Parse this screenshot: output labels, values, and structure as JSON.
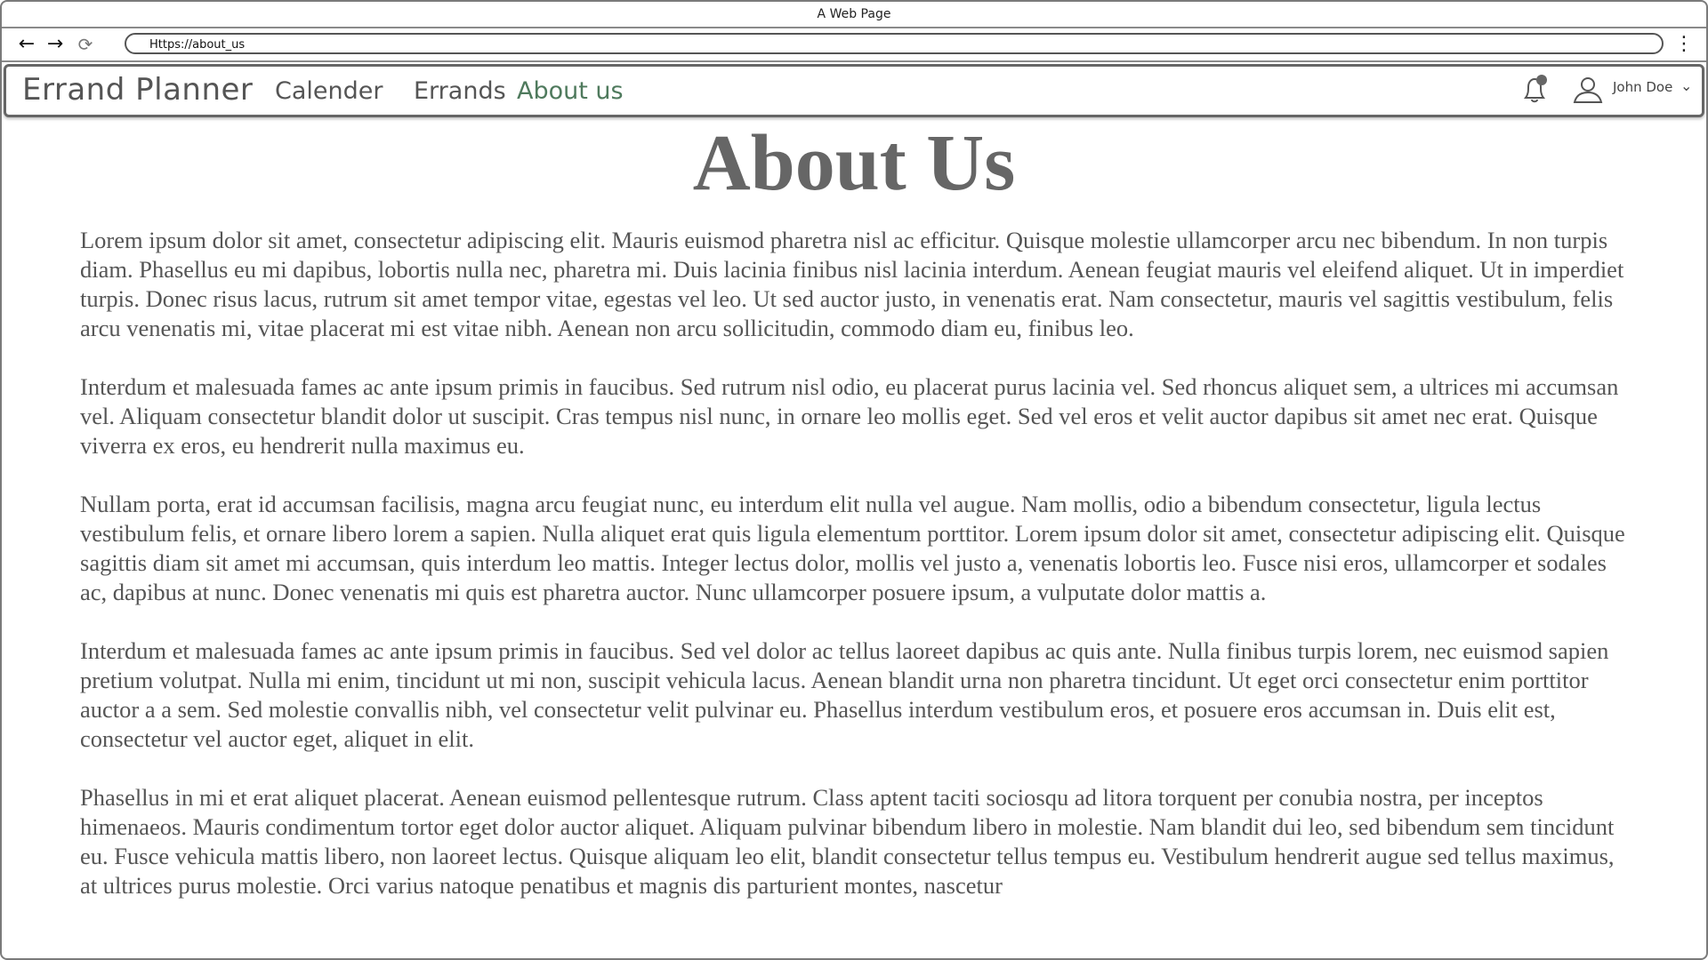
{
  "window": {
    "title": "A Web Page"
  },
  "browser": {
    "url": "Https://about_us",
    "back_icon": "arrow-left-icon",
    "forward_icon": "arrow-right-icon",
    "reload_icon": "reload-icon",
    "menu_icon": "kebab-menu-icon"
  },
  "navbar": {
    "brand": "Errand Planner",
    "links": [
      {
        "label": "Calender",
        "active": false
      },
      {
        "label": "Errands",
        "active": false
      },
      {
        "label": "About us",
        "active": true
      }
    ],
    "active_color": "#4f7a5d",
    "notification_icon": "bell-icon",
    "user_icon": "user-icon",
    "user_name": "John Doe",
    "user_menu_icon": "chevron-down-icon"
  },
  "main": {
    "title": "About Us",
    "paragraphs": [
      "Lorem ipsum dolor sit amet, consectetur adipiscing elit. Mauris euismod pharetra nisl ac efficitur. Quisque molestie ullamcorper arcu nec bibendum. In non turpis diam. Phasellus eu mi dapibus, lobortis nulla nec, pharetra mi. Duis lacinia finibus nisl lacinia interdum. Aenean feugiat mauris vel eleifend aliquet. Ut in imperdiet turpis. Donec risus lacus, rutrum sit amet tempor vitae, egestas vel leo. Ut sed auctor justo, in venenatis erat. Nam consectetur, mauris vel sagittis vestibulum, felis arcu venenatis mi, vitae placerat mi est vitae nibh. Aenean non arcu sollicitudin, commodo diam eu, finibus leo.",
      "Interdum et malesuada fames ac ante ipsum primis in faucibus. Sed rutrum nisl odio, eu placerat purus lacinia vel. Sed rhoncus aliquet sem, a ultrices mi accumsan vel. Aliquam consectetur blandit dolor ut suscipit. Cras tempus nisl nunc, in ornare leo mollis eget. Sed vel eros et velit auctor dapibus sit amet nec erat. Quisque viverra ex eros, eu hendrerit nulla maximus eu.",
      "Nullam porta, erat id accumsan facilisis, magna arcu feugiat nunc, eu interdum elit nulla vel augue. Nam mollis, odio a bibendum consectetur, ligula lectus vestibulum felis, et ornare libero lorem a sapien. Nulla aliquet erat quis ligula elementum porttitor. Lorem ipsum dolor sit amet, consectetur adipiscing elit. Quisque sagittis diam sit amet mi accumsan, quis interdum leo mattis. Integer lectus dolor, mollis vel justo a, venenatis lobortis leo. Fusce nisi eros, ullamcorper et sodales ac, dapibus at nunc. Donec venenatis mi quis est pharetra auctor. Nunc ullamcorper posuere ipsum, a vulputate dolor mattis a.",
      "Interdum et malesuada fames ac ante ipsum primis in faucibus. Sed vel dolor ac tellus laoreet dapibus ac quis ante. Nulla finibus turpis lorem, nec euismod sapien pretium volutpat. Nulla mi enim, tincidunt ut mi non, suscipit vehicula lacus. Aenean blandit urna non pharetra tincidunt. Ut eget orci consectetur enim porttitor auctor a a sem. Sed molestie convallis nibh, vel consectetur velit pulvinar eu. Phasellus interdum vestibulum eros, et posuere eros accumsan in. Duis elit est, consectetur vel auctor eget, aliquet in elit.",
      "Phasellus in mi et erat aliquet placerat. Aenean euismod pellentesque rutrum. Class aptent taciti sociosqu ad litora torquent per conubia nostra, per inceptos himenaeos. Mauris condimentum tortor eget dolor auctor aliquet. Aliquam pulvinar bibendum libero in molestie. Nam blandit dui leo, sed bibendum sem tincidunt eu. Fusce vehicula mattis libero, non laoreet lectus. Quisque aliquam leo elit, blandit consectetur tellus tempus eu. Vestibulum hendrerit augue sed tellus maximus, at ultrices purus molestie. Orci varius natoque penatibus et magnis dis parturient montes, nascetur"
    ]
  }
}
